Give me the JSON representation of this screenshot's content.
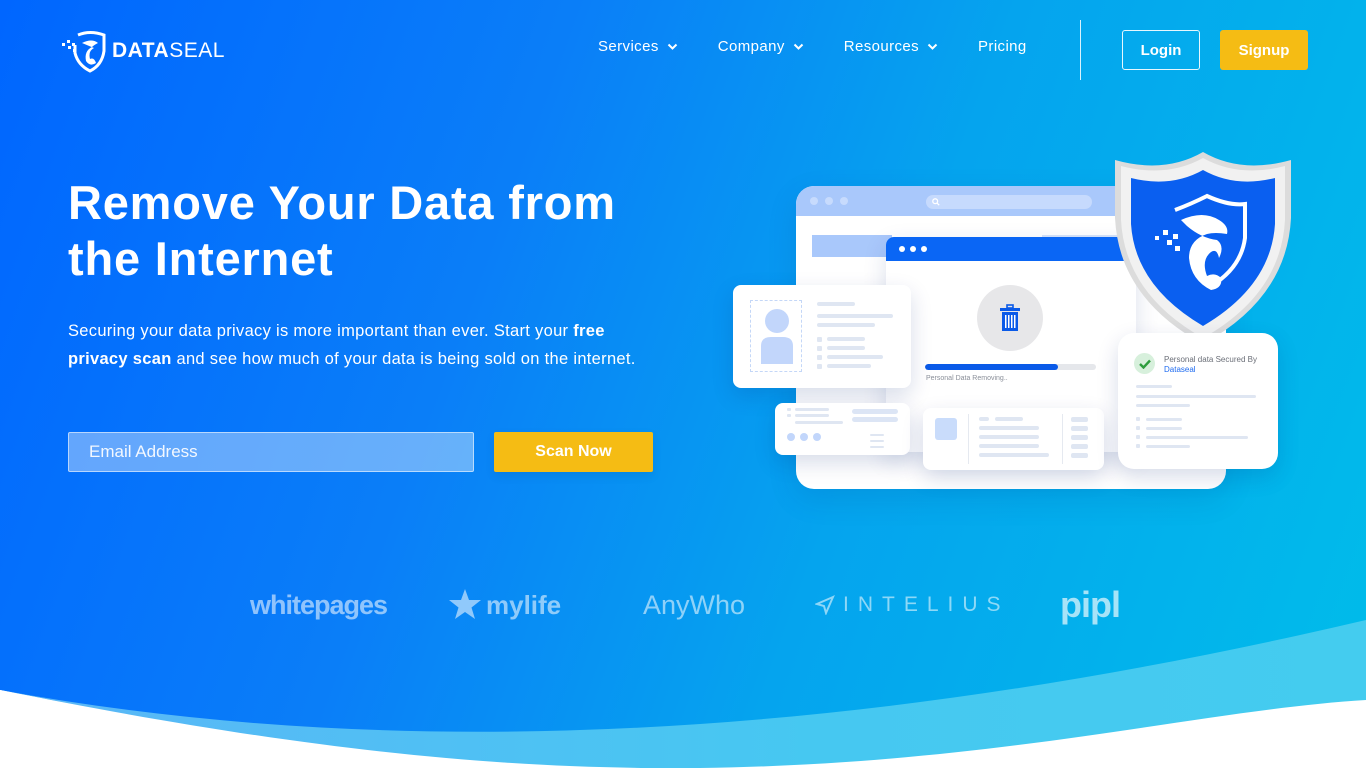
{
  "brand": {
    "name_bold": "DATA",
    "name_light": "SEAL",
    "logo_icon": "seal-shield-icon"
  },
  "nav": {
    "items": [
      {
        "label": "Services",
        "has_dropdown": true
      },
      {
        "label": "Company",
        "has_dropdown": true
      },
      {
        "label": "Resources",
        "has_dropdown": true
      },
      {
        "label": "Pricing",
        "has_dropdown": false
      }
    ],
    "login_label": "Login",
    "signup_label": "Signup"
  },
  "hero": {
    "headline_line1": "Remove Your Data from",
    "headline_line2": "the Internet",
    "sub_part1": "Securing your data privacy is more important than ever. Start your ",
    "sub_bold": "free privacy scan",
    "sub_part2": " and see how much of your data is being sold on the internet.",
    "email_placeholder": "Email Address",
    "email_value": "",
    "scan_button_label": "Scan Now"
  },
  "partners": [
    "whitepages",
    "mylife",
    "AnyWho",
    "INTELIUS",
    "pipl"
  ],
  "illustration": {
    "progress_label": "Personal Data Removing..",
    "progress_percent": 78,
    "secured_line1": "Personal data Secured By",
    "secured_brand": "Dataseal"
  },
  "colors": {
    "primary_blue": "#0066ff",
    "gradient_end": "#00bdea",
    "accent_yellow": "#f5bc14",
    "success_green": "#2e9e3e"
  }
}
